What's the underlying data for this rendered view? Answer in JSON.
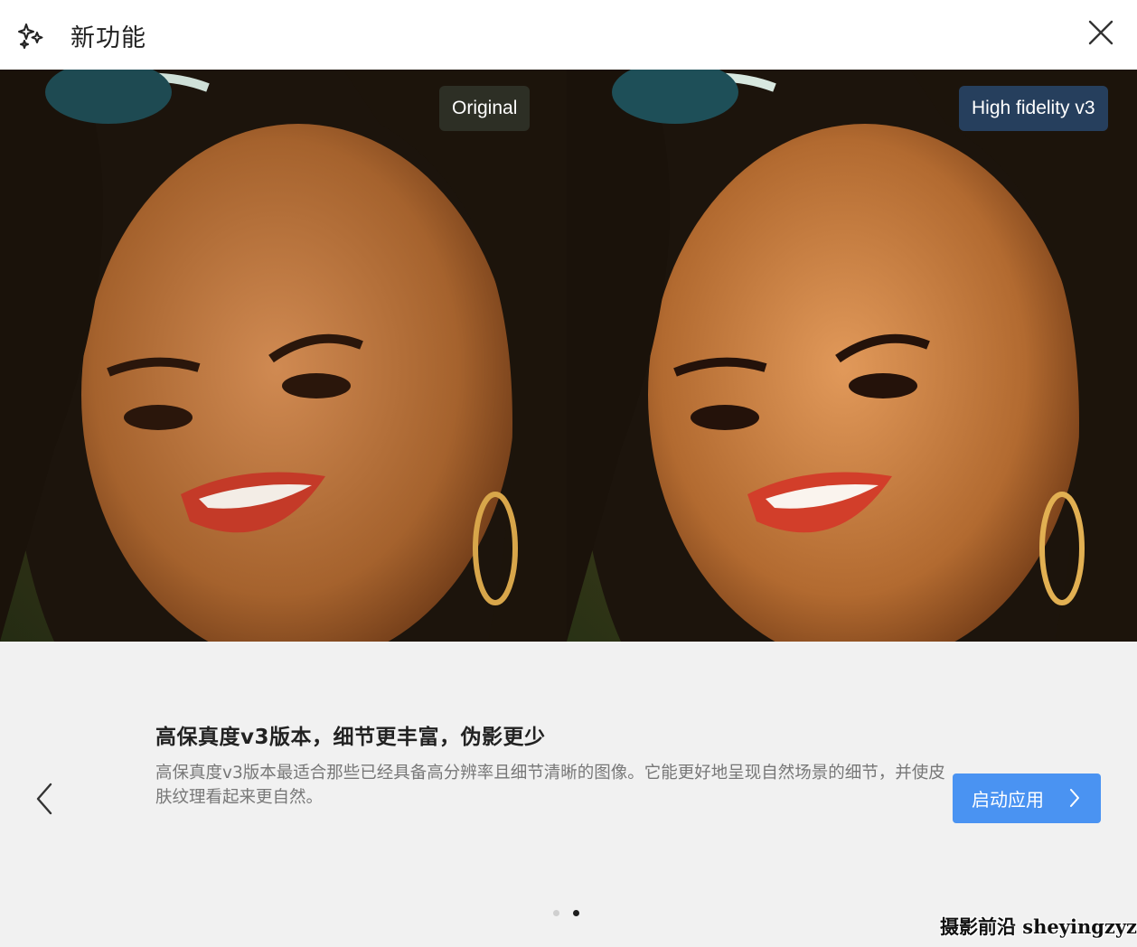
{
  "header": {
    "title": "新功能",
    "icon": "sparkle-icon",
    "close_icon": "close-icon"
  },
  "comparison": {
    "left_label": "Original",
    "right_label": "High fidelity v3"
  },
  "feature": {
    "title": "高保真度v3版本，细节更丰富，伪影更少",
    "description": "高保真度v3版本最适合那些已经具备高分辨率且细节清晰的图像。它能更好地呈现自然场景的细节，并使皮肤纹理看起来更自然。",
    "launch_label": "启动应用"
  },
  "pagination": {
    "total": 2,
    "active": 2
  },
  "watermark": "摄影前沿 sheyingzyz.com",
  "colors": {
    "accent": "#4a93f2",
    "background": "#f1f1f1"
  }
}
